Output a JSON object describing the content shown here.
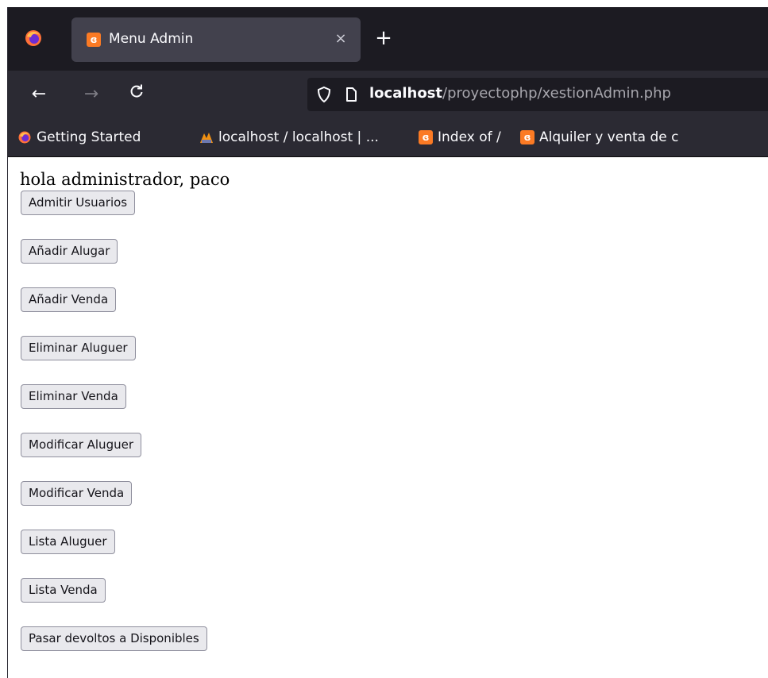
{
  "browser": {
    "tab": {
      "title": "Menu Admin",
      "close_glyph": "×"
    },
    "new_tab_glyph": "+",
    "nav": {
      "back_glyph": "←",
      "forward_glyph": "→",
      "reload_glyph": "C"
    },
    "url": {
      "host": "localhost",
      "path": "/proyectophp/xestionAdmin.php"
    },
    "bookmarks": [
      {
        "label": "Getting Started",
        "icon": "firefox-icon"
      },
      {
        "label": "localhost / localhost | ...",
        "icon": "phpmyadmin-icon"
      },
      {
        "label": "Index of /",
        "icon": "xampp-icon"
      },
      {
        "label": "Alquiler y venta de c",
        "icon": "xampp-icon"
      }
    ]
  },
  "page": {
    "greeting": "hola administrador, paco",
    "buttons": [
      "Admitir Usuarios",
      "Añadir Alugar",
      "Añadir Venda",
      "Eliminar Aluguer",
      "Eliminar Venda",
      "Modificar Aluguer",
      "Modificar Venda",
      "Lista Aluguer",
      "Lista Venda",
      "Pasar devoltos a Disponibles"
    ]
  },
  "colors": {
    "tabstrip": "#1c1b22",
    "toolbar": "#2b2a33",
    "active_tab": "#42414d",
    "xampp_orange": "#fb7a24"
  }
}
